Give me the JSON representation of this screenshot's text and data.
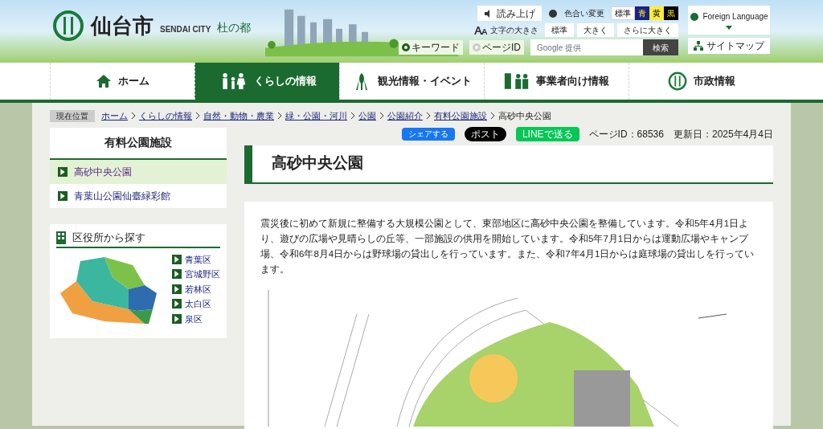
{
  "header": {
    "city_name": "仙台市",
    "city_name_en": "SENDAI CITY",
    "tagline": "杜の都"
  },
  "tools": {
    "read_aloud": "読み上げ",
    "color_label": "色合い変更",
    "color_options": [
      {
        "label": "標準",
        "kind": "standard"
      },
      {
        "label": "青",
        "kind": "blue"
      },
      {
        "label": "黄",
        "kind": "yellow"
      },
      {
        "label": "黒",
        "kind": "black"
      }
    ],
    "text_size_label": "文字の大きさ",
    "text_size_options": [
      "標準",
      "大きく",
      "さらに大きく"
    ],
    "foreign_language": "Foreign Language",
    "sitemap": "サイトマップ"
  },
  "search": {
    "modes": [
      {
        "label": "キーワード",
        "selected": true
      },
      {
        "label": "ページID",
        "selected": false
      }
    ],
    "placeholder": "Google 提供",
    "button": "検索"
  },
  "nav": [
    {
      "label": "ホーム",
      "selected": false
    },
    {
      "label": "くらしの情報",
      "selected": true
    },
    {
      "label": "観光情報・イベント",
      "selected": false
    },
    {
      "label": "事業者向け情報",
      "selected": false
    },
    {
      "label": "市政情報",
      "selected": false
    }
  ],
  "breadcrumb": {
    "label": "現在位置",
    "links": [
      "ホーム",
      "くらしの情報",
      "自然・動物・農業",
      "緑・公園・河川",
      "公園",
      "公園紹介",
      "有料公園施設"
    ],
    "current": "高砂中央公園"
  },
  "share": {
    "facebook": "シェアする",
    "x": "ポスト",
    "line": "LINEで送る"
  },
  "page_id": "ページID：68536",
  "updated": "更新日：2025年4月4日",
  "sidebar": {
    "title": "有料公園施設",
    "items": [
      {
        "label": "高砂中央公園",
        "selected": true
      },
      {
        "label": "青葉山公園仙臺緑彩館",
        "selected": false
      }
    ]
  },
  "wards": {
    "title": "区役所から探す",
    "items": [
      "青葉区",
      "宮城野区",
      "若林区",
      "太白区",
      "泉区"
    ]
  },
  "main": {
    "title": "高砂中央公園",
    "paragraph": "震災後に初めて新規に整備する大規模公園として、東部地区に高砂中央公園を整備しています。令和5年4月1日より、遊びの広場や見晴らしの丘等、一部施設の供用を開始しています。令和5年7月1日からは運動広場やキャンプ場、令和6年8月4日からは野球場の貸出しを行っています。また、令和7年4月1日からは庭球場の貸出しを行っています。"
  }
}
